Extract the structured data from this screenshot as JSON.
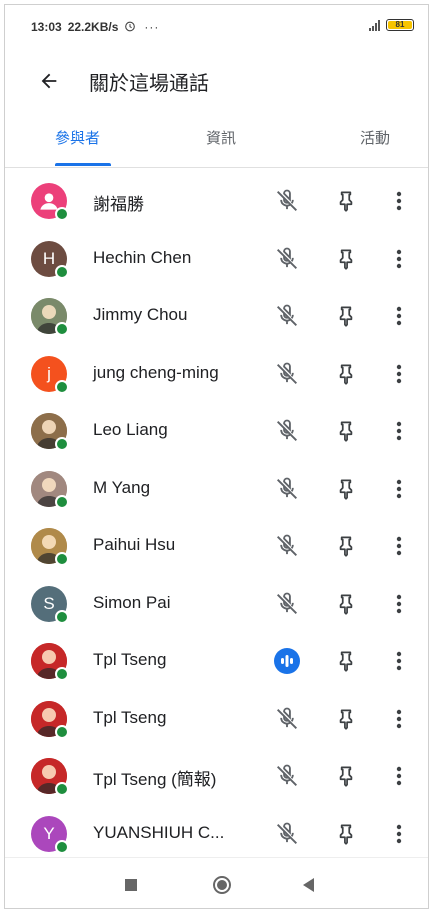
{
  "status_bar": {
    "time": "13:03",
    "network_speed": "22.2KB/s",
    "alarm_icon": "alarm-icon",
    "more": "···",
    "battery": "81"
  },
  "app_bar": {
    "title": "關於這場通話",
    "back_icon": "arrow-back-icon"
  },
  "tabs": [
    {
      "label": "參與者",
      "active": true
    },
    {
      "label": "資訊",
      "active": false
    },
    {
      "label": "活動",
      "active": false
    }
  ],
  "participants": [
    {
      "name": "謝福勝",
      "avatar_letter": "",
      "avatar_color": "#ec407a",
      "avatar_kind": "person-icon",
      "status": "muted"
    },
    {
      "name": "Hechin Chen",
      "avatar_letter": "H",
      "avatar_color": "#6d4c41",
      "avatar_kind": "letter",
      "status": "muted"
    },
    {
      "name": "Jimmy Chou",
      "avatar_letter": "",
      "avatar_color": "#7a8a6a",
      "avatar_kind": "photo",
      "status": "muted"
    },
    {
      "name": "jung cheng-ming",
      "avatar_letter": "j",
      "avatar_color": "#f4511e",
      "avatar_kind": "letter",
      "status": "muted"
    },
    {
      "name": "Leo Liang",
      "avatar_letter": "",
      "avatar_color": "#8d6e4a",
      "avatar_kind": "photo",
      "status": "muted"
    },
    {
      "name": "M Yang",
      "avatar_letter": "",
      "avatar_color": "#a1887f",
      "avatar_kind": "photo",
      "status": "muted"
    },
    {
      "name": "Paihui Hsu",
      "avatar_letter": "",
      "avatar_color": "#b08a4a",
      "avatar_kind": "photo",
      "status": "muted"
    },
    {
      "name": "Simon Pai",
      "avatar_letter": "S",
      "avatar_color": "#546e7a",
      "avatar_kind": "letter",
      "status": "muted"
    },
    {
      "name": "Tpl Tseng",
      "avatar_letter": "",
      "avatar_color": "#c62828",
      "avatar_kind": "photo",
      "status": "speaking"
    },
    {
      "name": "Tpl Tseng",
      "avatar_letter": "",
      "avatar_color": "#c62828",
      "avatar_kind": "photo",
      "status": "muted"
    },
    {
      "name": "Tpl Tseng (簡報)",
      "avatar_letter": "",
      "avatar_color": "#c62828",
      "avatar_kind": "photo",
      "status": "muted"
    },
    {
      "name": "YUANSHIUH C...",
      "avatar_letter": "Y",
      "avatar_color": "#ab47bc",
      "avatar_kind": "letter",
      "status": "muted"
    }
  ],
  "colors": {
    "accent": "#1a73e8",
    "online": "#1e8e3e"
  }
}
